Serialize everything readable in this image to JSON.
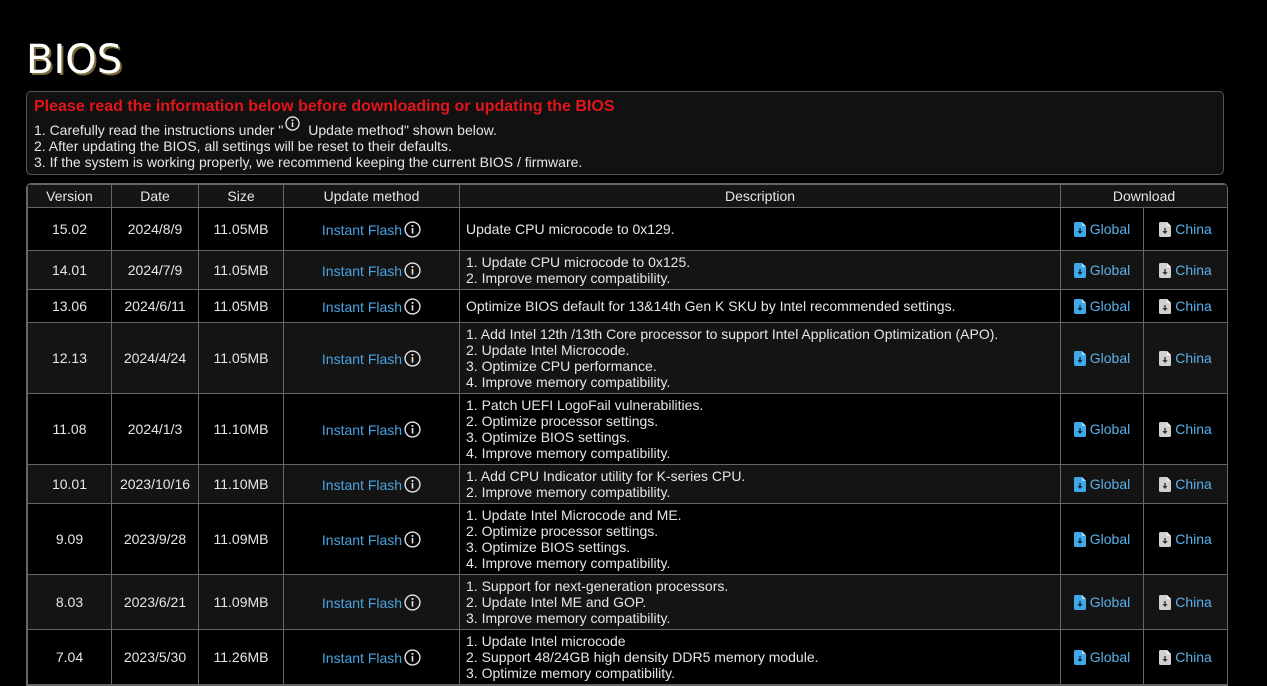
{
  "page": {
    "title": "BIOS"
  },
  "notice": {
    "title": "Please read the information below before downloading or updating the BIOS",
    "line1_prefix": "1. Carefully read the instructions under \"",
    "line1_suffix": " Update method\" shown below.",
    "line2": "2. After updating the BIOS, all settings will be reset to their defaults.",
    "line3": "3. If the system is working properly, we recommend keeping the current BIOS / firmware."
  },
  "colors": {
    "notice_title": "#e3141a",
    "link": "#4aa3e0",
    "global_icon": "#3fa8e6",
    "china_icon": "#d0d0d0"
  },
  "table": {
    "headers": {
      "version": "Version",
      "date": "Date",
      "size": "Size",
      "update_method": "Update method",
      "description": "Description",
      "download": "Download"
    },
    "rows": [
      {
        "version": "15.02",
        "date": "2024/8/9",
        "size": "11.05MB",
        "method": "Instant Flash",
        "description": [
          "Update CPU microcode to 0x129."
        ],
        "global": "Global",
        "china": "China"
      },
      {
        "version": "14.01",
        "date": "2024/7/9",
        "size": "11.05MB",
        "method": "Instant Flash",
        "description": [
          "1. Update CPU microcode to 0x125.",
          "2. Improve memory compatibility."
        ],
        "global": "Global",
        "china": "China"
      },
      {
        "version": "13.06",
        "date": "2024/6/11",
        "size": "11.05MB",
        "method": "Instant Flash",
        "description": [
          "Optimize BIOS default for 13&14th Gen K SKU by Intel recommended settings."
        ],
        "global": "Global",
        "china": "China"
      },
      {
        "version": "12.13",
        "date": "2024/4/24",
        "size": "11.05MB",
        "method": "Instant Flash",
        "description": [
          "1. Add Intel 12th /13th Core processor to support Intel Application Optimization (APO).",
          "2. Update Intel Microcode.",
          "3. Optimize CPU performance.",
          "4. Improve memory compatibility."
        ],
        "global": "Global",
        "china": "China"
      },
      {
        "version": "11.08",
        "date": "2024/1/3",
        "size": "11.10MB",
        "method": "Instant Flash",
        "description": [
          "1. Patch UEFI LogoFail vulnerabilities.",
          "2. Optimize processor settings.",
          "3. Optimize BIOS settings.",
          "4. Improve memory compatibility."
        ],
        "global": "Global",
        "china": "China"
      },
      {
        "version": "10.01",
        "date": "2023/10/16",
        "size": "11.10MB",
        "method": "Instant Flash",
        "description": [
          "1. Add CPU Indicator utility for K-series CPU.",
          "2. Improve memory compatibility."
        ],
        "global": "Global",
        "china": "China"
      },
      {
        "version": "9.09",
        "date": "2023/9/28",
        "size": "11.09MB",
        "method": "Instant Flash",
        "description": [
          "1. Update Intel Microcode and ME.",
          "2. Optimize processor settings.",
          "3. Optimize BIOS settings.",
          "4. Improve memory compatibility."
        ],
        "global": "Global",
        "china": "China"
      },
      {
        "version": "8.03",
        "date": "2023/6/21",
        "size": "11.09MB",
        "method": "Instant Flash",
        "description": [
          "1. Support for next-generation processors.",
          "2. Update Intel ME and GOP.",
          "3. Improve memory compatibility."
        ],
        "global": "Global",
        "china": "China"
      },
      {
        "version": "7.04",
        "date": "2023/5/30",
        "size": "11.26MB",
        "method": "Instant Flash",
        "description": [
          "1. Update Intel microcode",
          "2. Support 48/24GB high density DDR5 memory module.",
          "3. Optimize memory compatibility."
        ],
        "global": "Global",
        "china": "China"
      }
    ]
  }
}
